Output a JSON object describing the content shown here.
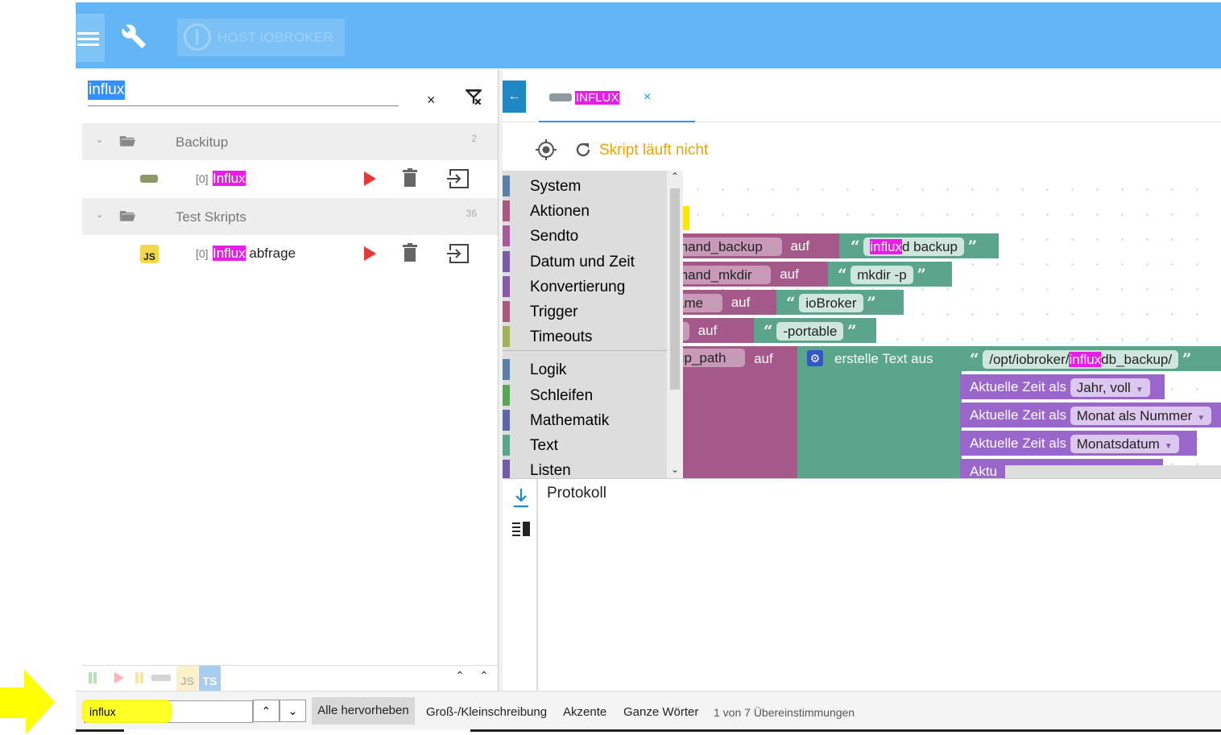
{
  "header": {
    "host_label": "HOST IOBROKER",
    "color": "#64b5f6"
  },
  "search": {
    "value": "influx",
    "clear_symbol": "×"
  },
  "tree": {
    "folders": [
      {
        "name": "Backitup",
        "count": "2",
        "scripts": [
          {
            "index": "[0]",
            "name_match": "Influx",
            "name_rest": "",
            "icon": "blockly-icon"
          }
        ]
      },
      {
        "name": "Test Skripts",
        "count": "36",
        "scripts": [
          {
            "index": "[0]",
            "name_match": "Influx",
            "name_rest": " abfrage",
            "icon": "js-icon"
          }
        ]
      }
    ],
    "bottom_js": "JS",
    "bottom_ts": "TS"
  },
  "editor": {
    "tab_name": "INFLUX",
    "tab_close": "×",
    "status": "Skript läuft nicht",
    "toolbox": [
      "System",
      "Aktionen",
      "Sendto",
      "Datum und Zeit",
      "Konvertierung",
      "Trigger",
      "Timeouts",
      "Logik",
      "Schleifen",
      "Mathematik",
      "Text",
      "Listen"
    ],
    "toolbox_colors": [
      "#5b80a5",
      "#a55b80",
      "#a55b99",
      "#7a5ba5",
      "#8a5ba5",
      "#a55b80",
      "#a5b05b",
      "#5b80a5",
      "#5ba55b",
      "#5b67a5",
      "#5ba58c",
      "#745ba5"
    ],
    "blocks": {
      "var1": "mand_backup",
      "var2": "mand_mkdir",
      "var3": "ame",
      "var5": "up_path",
      "auf": "auf",
      "str1_match": "influx",
      "str1_rest": "d backup",
      "str2": "mkdir  -p",
      "str3": "ioBroker",
      "str4": "-portable",
      "create_text": "erstelle Text aus",
      "path_pre": "/opt/iobroker/",
      "path_match": "influx",
      "path_post": "db_backup/",
      "time_label": "Aktuelle Zeit als",
      "time_opts": [
        "Jahr, voll",
        "Monat als Nummer",
        "Monatsdatum"
      ],
      "time_cut": "Aktu"
    },
    "log_title": "Protokoll"
  },
  "findbar": {
    "value": "influx",
    "highlight_all": "Alle hervorheben",
    "match_case": "Groß-/Kleinschreibung",
    "accents": "Akzente",
    "whole_words": "Ganze Wörter",
    "result": "1 von 7 Übereinstimmungen"
  }
}
